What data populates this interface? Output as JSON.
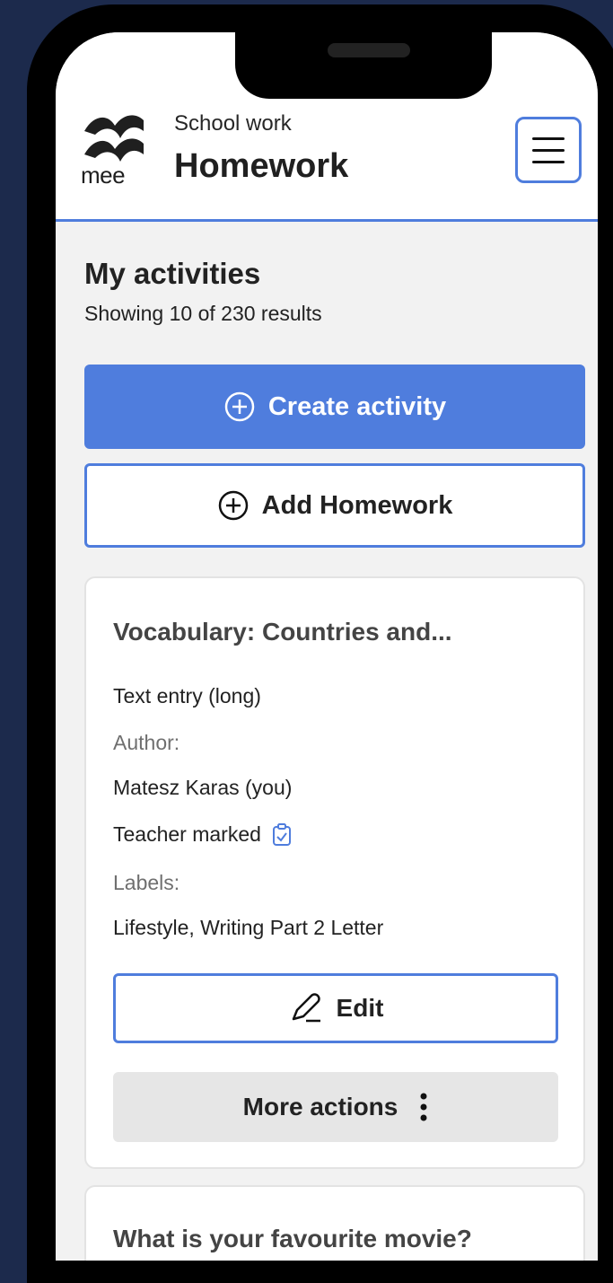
{
  "header": {
    "logo_text": "mee",
    "kicker": "School work",
    "title": "Homework"
  },
  "main": {
    "section_title": "My activities",
    "results": "Showing 10 of 230 results",
    "create_label": "Create activity",
    "add_label": "Add Homework"
  },
  "cards": [
    {
      "title": "Vocabulary: Countries and...",
      "type": "Text entry (long)",
      "author_label": "Author:",
      "author": "Matesz Karas (you)",
      "marking": "Teacher marked",
      "labels_label": "Labels:",
      "labels": "Lifestyle, Writing Part 2 Letter",
      "edit_label": "Edit",
      "more_label": "More actions"
    },
    {
      "title": "What is your favourite movie?"
    }
  ],
  "colors": {
    "accent": "#4f7ddd",
    "page_bg": "#1c2a4c",
    "screen_bg": "#f2f2f2"
  }
}
